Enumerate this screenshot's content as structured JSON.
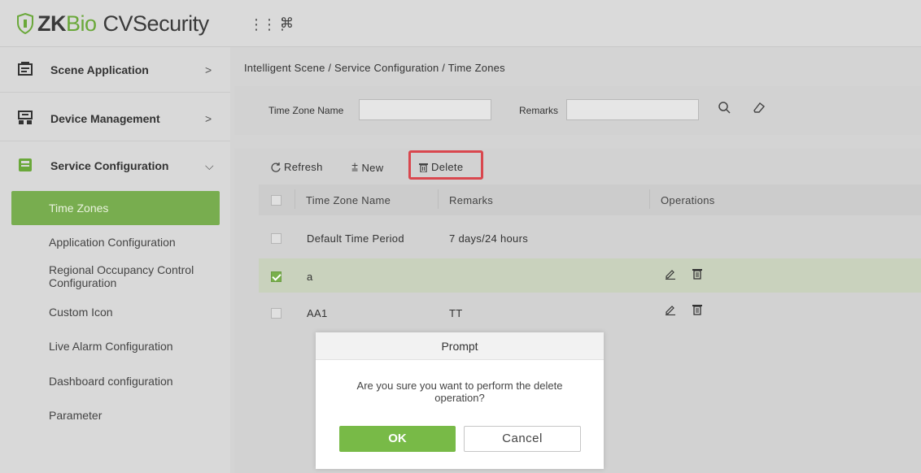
{
  "app": {
    "logo_zk": "ZK",
    "logo_bio": "Bio",
    "logo_rest": "CVSecurity"
  },
  "topbar": {
    "grid_icon": "grid-icon",
    "command_icon": "command-icon"
  },
  "sidebar": {
    "groups": [
      {
        "label": "Scene Application",
        "icon": "scene-icon",
        "chevron": ">"
      },
      {
        "label": "Device Management",
        "icon": "device-icon",
        "chevron": ">"
      },
      {
        "label": "Service Configuration",
        "icon": "service-icon",
        "chevron": "⌵"
      }
    ],
    "items": [
      {
        "label": "Time Zones",
        "active": true
      },
      {
        "label": "Application Configuration"
      },
      {
        "label": "Regional Occupancy Control Configuration"
      },
      {
        "label": "Custom Icon"
      },
      {
        "label": "Live Alarm Configuration"
      },
      {
        "label": "Dashboard configuration"
      },
      {
        "label": "Parameter"
      }
    ]
  },
  "breadcrumb": "Intelligent Scene / Service Configuration / Time Zones",
  "search": {
    "time_zone_label": "Time Zone Name",
    "time_zone_value": "",
    "remarks_label": "Remarks",
    "remarks_value": ""
  },
  "toolbar": {
    "refresh_label": "Refresh",
    "new_label": "New",
    "delete_label": "Delete"
  },
  "table": {
    "columns": [
      "Time Zone Name",
      "Remarks",
      "Operations"
    ],
    "rows": [
      {
        "name": "Default Time Period",
        "remarks": "7 days/24 hours",
        "checked": false,
        "operations": false
      },
      {
        "name": "a",
        "remarks": "",
        "checked": true,
        "operations": true
      },
      {
        "name": "AA1",
        "remarks": "TT",
        "checked": false,
        "operations": true
      }
    ]
  },
  "dialog": {
    "title": "Prompt",
    "message": "Are you sure you want to perform the delete operation?",
    "ok_label": "OK",
    "cancel_label": "Cancel"
  },
  "colors": {
    "accent_green": "#78ad4f",
    "highlight_red": "#d9474e"
  }
}
